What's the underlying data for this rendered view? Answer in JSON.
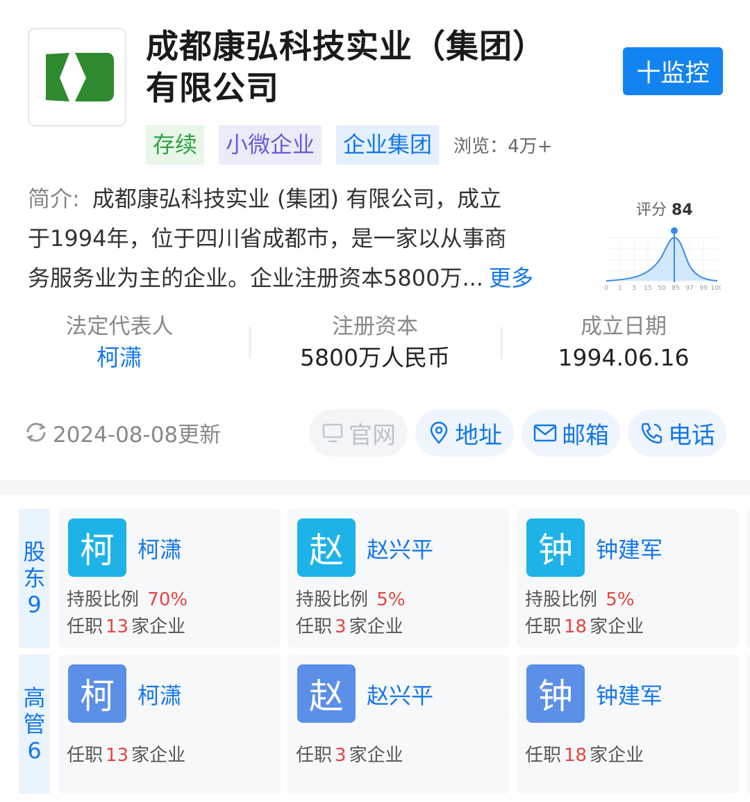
{
  "company": {
    "name_line1": "成都康弘科技实业（集团）",
    "name_line2": "有限公司",
    "monitor_label": "十监控",
    "tags": [
      "存续",
      "小微企业",
      "企业集团"
    ],
    "views_label": "浏览：",
    "views_value": "4万+"
  },
  "intro": {
    "label": "简介:",
    "line1": "成都康弘科技实业 (集团) 有限公司，成立",
    "line2": "于1994年，位于四川省成都市，是一家以从事商",
    "line3": "务服务业为主的企业。企业注册资本5800万...",
    "more": "更多"
  },
  "score": {
    "label": "评分",
    "value": "84",
    "ticks": [
      "0",
      "1",
      "3",
      "15",
      "50",
      "85",
      "97",
      "99",
      "100"
    ]
  },
  "stats": [
    {
      "key": "法定代表人",
      "value": "柯潇"
    },
    {
      "key": "注册资本",
      "value": "5800万人民币"
    },
    {
      "key": "成立日期",
      "value": "1994.06.16"
    }
  ],
  "update_text": "2024-08-08更新",
  "actions": [
    "官网",
    "地址",
    "邮箱",
    "电话"
  ],
  "shareholders": {
    "side_label": [
      "股",
      "东",
      "9"
    ],
    "items": [
      {
        "avatar": "柯",
        "name": "柯潇",
        "ratio_label": "持股比例",
        "ratio": "70%",
        "job_prefix": "任职",
        "job_count": "13",
        "job_suffix": "家企业"
      },
      {
        "avatar": "赵",
        "name": "赵兴平",
        "ratio_label": "持股比例",
        "ratio": "5%",
        "job_prefix": "任职",
        "job_count": "3",
        "job_suffix": "家企业"
      },
      {
        "avatar": "钟",
        "name": "钟建军",
        "ratio_label": "持股比例",
        "ratio": "5%",
        "job_prefix": "任职",
        "job_count": "18",
        "job_suffix": "家企业"
      }
    ]
  },
  "executives": {
    "side_label": [
      "高",
      "管",
      "6"
    ],
    "items": [
      {
        "avatar": "柯",
        "name": "柯潇",
        "job_prefix": "任职",
        "job_count": "13",
        "job_suffix": "家企业"
      },
      {
        "avatar": "赵",
        "name": "赵兴平",
        "job_prefix": "任职",
        "job_count": "3",
        "job_suffix": "家企业"
      },
      {
        "avatar": "钟",
        "name": "钟建军",
        "job_prefix": "任职",
        "job_count": "18",
        "job_suffix": "家企业"
      }
    ]
  },
  "colors": {
    "accent": "#1283f0",
    "link": "#1477e8",
    "highlight_red": "#e5443c",
    "logo_green": "#2e8a2e"
  }
}
